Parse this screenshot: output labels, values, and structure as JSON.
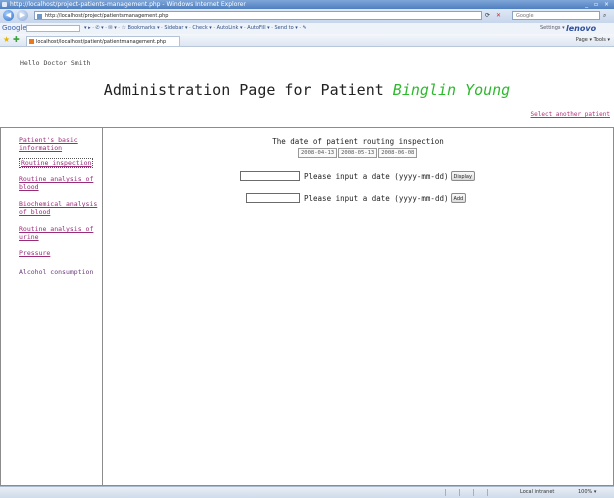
{
  "browser": {
    "window_title": "http://localhost/project-patients-management.php - Windows Internet Explorer",
    "window_controls": "_ ▫ ×",
    "url": "http://localhost/project/patientsmanagement.php",
    "search_placeholder": "Google",
    "google_toolbar": {
      "logo": "Google",
      "items": "▾ ▸ · ✆ ▾ · ✉ ▾ · ☆ Bookmarks ▾ · Sidebar ▾ · Check ▾ · AutoLink ▾ · AutoFill ▾ · Send to ▾ · ✎",
      "settings": "Settings ▾",
      "brand": "lenovo"
    },
    "tab_title": "localhost/localhost/patient/patientmanagement.php",
    "tab_tools": "Page ▾  Tools ▾",
    "status": {
      "zone": "Local intranet",
      "zoom": "100% ▾"
    }
  },
  "header": {
    "hello": "Hello Doctor Smith",
    "title_prefix": "Administration Page for Patient",
    "patient_name": "Binglin Young",
    "select_other": "Select another patient"
  },
  "sidebar": {
    "items": [
      {
        "label": "Patient's basic information"
      },
      {
        "label": "Routine inspection"
      },
      {
        "label": "Routine analysis of blood"
      },
      {
        "label": "Biochemical analysis of blood"
      },
      {
        "label": "Routine analysis of urine"
      },
      {
        "label": "Pressure"
      },
      {
        "label": "Alcohol consumption"
      }
    ]
  },
  "content": {
    "heading": "The date of patient routing inspection",
    "dates": [
      "2008-04-13",
      "2008-05-13",
      "2008-06-08"
    ],
    "display_form": {
      "label": "Please input a date (yyyy-mm-dd)",
      "value": "",
      "button": "Display"
    },
    "add_form": {
      "label": "Please input a date (yyyy-mm-dd)",
      "value": "",
      "button": "Add"
    }
  }
}
